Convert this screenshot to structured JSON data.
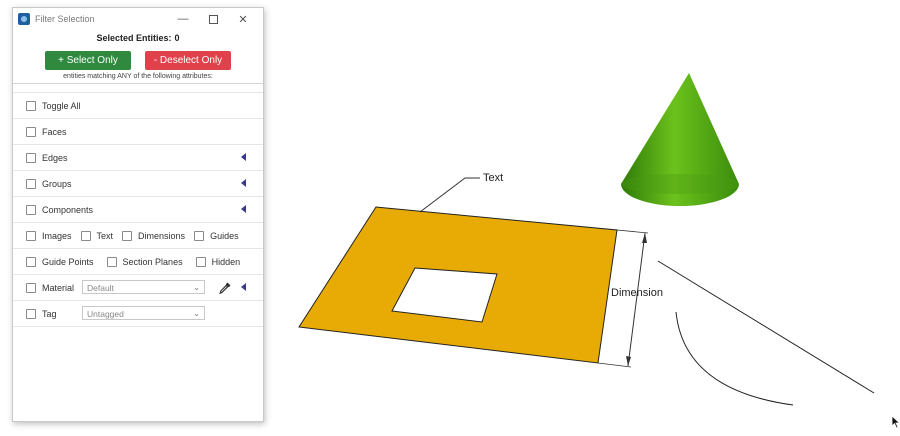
{
  "window": {
    "title": "Filter Selection",
    "minimize_glyph": "—",
    "close_glyph": "✕"
  },
  "header": {
    "selected_label": "Selected Entities:",
    "selected_count": "0",
    "select_only_label": "+ Select Only",
    "deselect_only_label": "- Deselect Only",
    "hint": "entities matching ANY of the following attributes:"
  },
  "filters": {
    "toggle_all": "Toggle All",
    "faces": "Faces",
    "edges": "Edges",
    "groups": "Groups",
    "components": "Components",
    "images": "Images",
    "text": "Text",
    "dimensions": "Dimensions",
    "guides": "Guides",
    "guide_points": "Guide Points",
    "section_planes": "Section Planes",
    "hidden": "Hidden",
    "material": "Material",
    "material_value": "Default",
    "tag": "Tag",
    "tag_value": "Untagged",
    "chevron_glyph": "⌄"
  },
  "scene": {
    "text_label": "Text",
    "dimension_label": "Dimension"
  },
  "colors": {
    "select_button": "#2f8a3f",
    "deselect_button": "#e0414b",
    "face_fill": "#e8ab05",
    "cone_green": "#4fa010",
    "expand_arrow": "#3a3a8a"
  },
  "icons": {
    "app": "app-icon",
    "eyedropper": "eyedropper-icon",
    "expand": "expand-arrow-icon",
    "cursor": "mouse-cursor-icon"
  }
}
